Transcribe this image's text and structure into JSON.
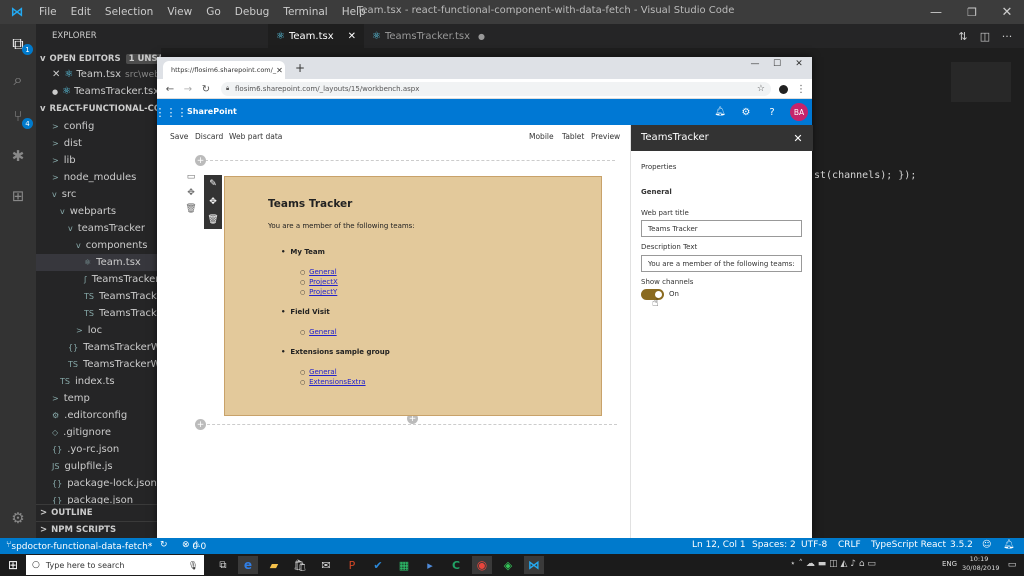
{
  "vscode": {
    "menu": [
      "File",
      "Edit",
      "Selection",
      "View",
      "Go",
      "Debug",
      "Terminal",
      "Help"
    ],
    "window_title": "Team.tsx - react-functional-component-with-data-fetch - Visual Studio Code",
    "tabs": [
      {
        "label": "Team.tsx"
      },
      {
        "label": "TeamsTracker.tsx"
      }
    ],
    "editor_code": "st(channels); });",
    "explorer": {
      "title": "EXPLORER",
      "open_editors": "OPEN EDITORS",
      "unsaved": "1 UNSAVED",
      "open_files": [
        {
          "name": "Team.tsx",
          "path": "src\\webp"
        },
        {
          "name": "TeamsTracker.tsx",
          "path": ""
        }
      ],
      "project": "REACT-FUNCTIONAL-COM...",
      "tree": [
        {
          "label": "config",
          "glyph": ">"
        },
        {
          "label": "dist",
          "glyph": ">"
        },
        {
          "label": "lib",
          "glyph": ">"
        },
        {
          "label": "node_modules",
          "glyph": ">"
        },
        {
          "label": "src",
          "glyph": "v"
        },
        {
          "label": "webparts",
          "glyph": "v"
        },
        {
          "label": "teamsTracker",
          "glyph": "v"
        },
        {
          "label": "components",
          "glyph": "v"
        },
        {
          "label": "Team.tsx",
          "glyph": "⚛"
        },
        {
          "label": "TeamsTracker.m...",
          "glyph": "ʃ"
        },
        {
          "label": "TeamsTracker.m...",
          "glyph": "TS"
        },
        {
          "label": "TeamsTracker.tsx",
          "glyph": "TS"
        },
        {
          "label": "loc",
          "glyph": ">"
        },
        {
          "label": "TeamsTrackerWeb...",
          "glyph": "{}"
        },
        {
          "label": "TeamsTrackerWeb...",
          "glyph": "TS"
        },
        {
          "label": "index.ts",
          "glyph": "TS"
        },
        {
          "label": "temp",
          "glyph": ">"
        },
        {
          "label": ".editorconfig",
          "glyph": "⚙"
        },
        {
          "label": ".gitignore",
          "glyph": "◇"
        },
        {
          "label": ".yo-rc.json",
          "glyph": "{}"
        },
        {
          "label": "gulpfile.js",
          "glyph": "JS"
        },
        {
          "label": "package-lock.json",
          "glyph": "{}"
        },
        {
          "label": "package.json",
          "glyph": "{}"
        }
      ],
      "outline": "OUTLINE",
      "npm_scripts": "NPM SCRIPTS"
    },
    "status": {
      "branch": "spdoctor-functional-data-fetch*",
      "errors": "0",
      "warnings": "0",
      "position": "Ln 12, Col 1",
      "spaces": "Spaces: 2",
      "encoding": "UTF-8",
      "eol": "CRLF",
      "language": "TypeScript React",
      "version": "3.5.2"
    }
  },
  "browser": {
    "tab_title": "https://flosim6.sharepoint.com/_",
    "url": "flosim6.sharepoint.com/_layouts/15/workbench.aspx"
  },
  "sharepoint": {
    "brand": "SharePoint",
    "avatar": "BA",
    "commands": {
      "save": "Save",
      "discard": "Discard",
      "webpart_data": "Web part data"
    },
    "views": {
      "mobile": "Mobile",
      "tablet": "Tablet",
      "preview": "Preview"
    },
    "webpart": {
      "title": "Teams Tracker",
      "description": "You are a member of the following teams:",
      "teams": [
        {
          "name": "My Team",
          "channels": [
            "General",
            "ProjectX",
            "ProjectY"
          ]
        },
        {
          "name": "Field Visit",
          "channels": [
            "General"
          ]
        },
        {
          "name": "Extensions sample group",
          "channels": [
            "General",
            "ExtensionsExtra"
          ]
        }
      ]
    },
    "panel": {
      "title": "TeamsTracker",
      "properties": "Properties",
      "group": "General",
      "title_label": "Web part title",
      "title_value": "Teams Tracker",
      "desc_label": "Description Text",
      "desc_value": "You are a member of the following teams:",
      "toggle_label": "Show channels",
      "toggle_state": "On"
    }
  },
  "taskbar": {
    "search_placeholder": "Type here to search",
    "lang": "ENG",
    "time": "10:19",
    "date": "30/08/2019"
  },
  "colors": {
    "sp_blue": "#0078d4",
    "vscode_blue": "#007acc",
    "webpart_bg": "#e3c99b",
    "toggle_on": "#8a6a1f"
  }
}
